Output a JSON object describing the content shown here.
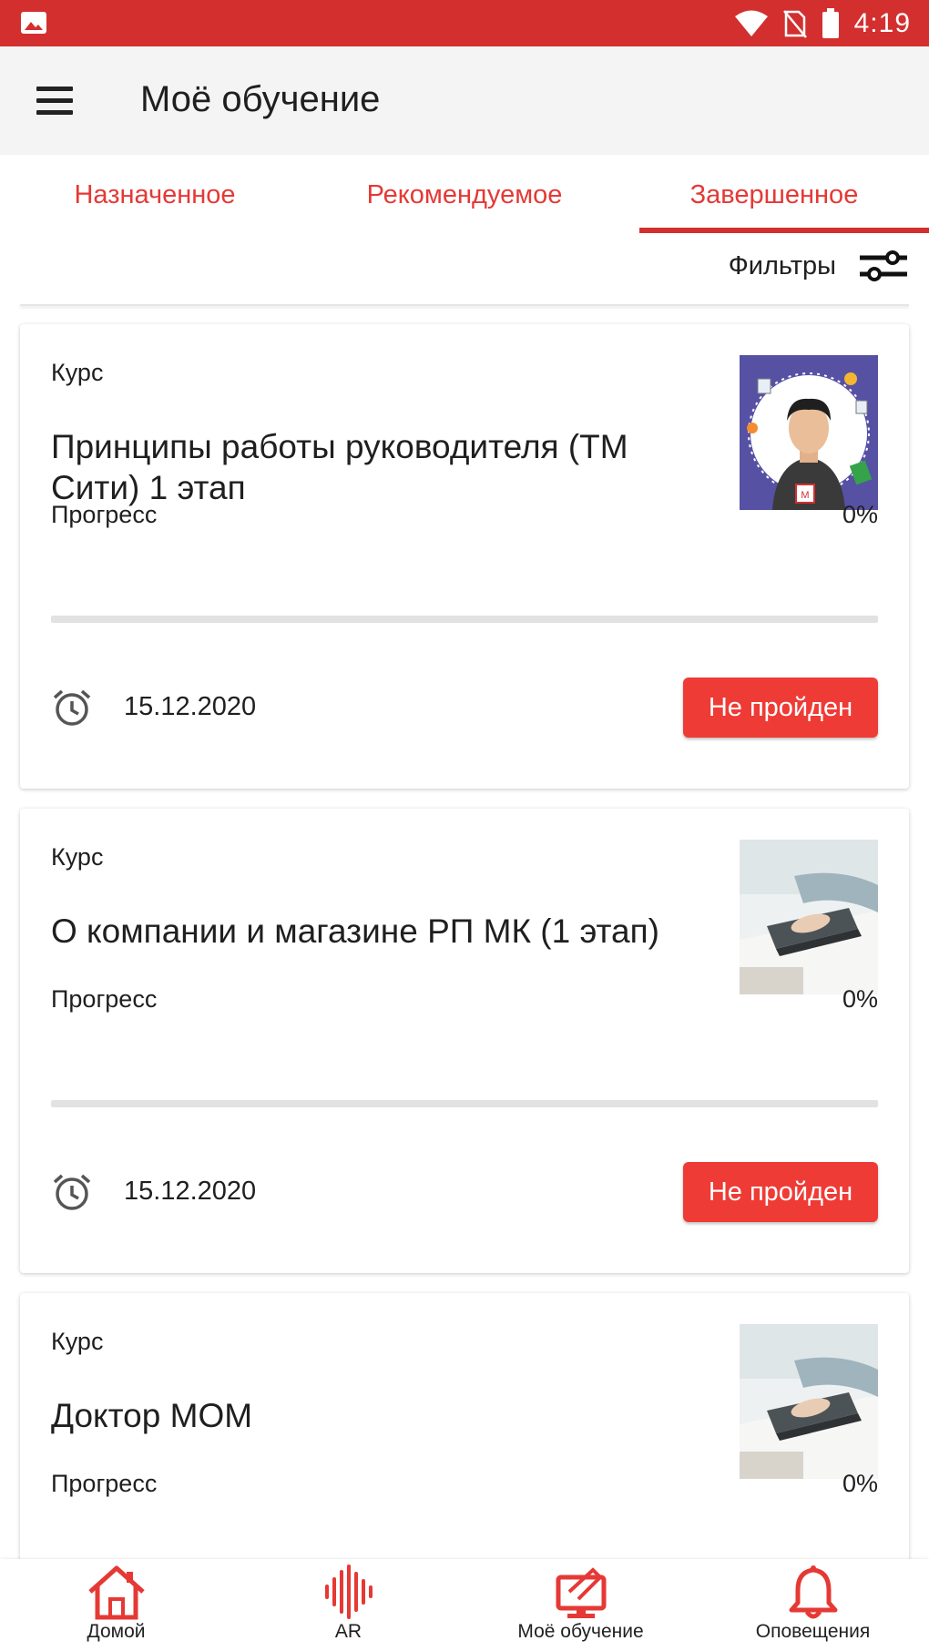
{
  "status_bar": {
    "time": "4:19",
    "left_icon": "image-icon",
    "right_icons": [
      "wifi-icon",
      "no-sim-icon",
      "battery-icon"
    ]
  },
  "app_bar": {
    "title": "Моё обучение",
    "menu_icon": "menu-icon"
  },
  "tabs": [
    {
      "label": "Назначенное",
      "active": false
    },
    {
      "label": "Рекомендуемое",
      "active": false
    },
    {
      "label": "Завершенное",
      "active": true
    }
  ],
  "filters": {
    "label": "Фильтры",
    "icon": "tune-icon"
  },
  "cards": [
    {
      "type": "Курс",
      "title": "Принципы работы руководителя  (ТМ Сити) 1 этап",
      "progress_label": "Прогресс",
      "progress_value": "0%",
      "progress_fraction": 0,
      "date": "15.12.2020",
      "status_button": "Не пройден",
      "thumbnail": "manager-avatar-thumbnail"
    },
    {
      "type": "Курс",
      "title": "О компании и магазине РП МК (1 этап)",
      "progress_label": "Прогресс",
      "progress_value": "0%",
      "progress_fraction": 0,
      "date": "15.12.2020",
      "status_button": "Не пройден",
      "thumbnail": "office-work-thumbnail"
    },
    {
      "type": "Курс",
      "title": "Доктор МОМ",
      "progress_label": "Прогресс",
      "progress_value": "0%",
      "progress_fraction": 0,
      "thumbnail": "office-work-thumbnail"
    }
  ],
  "bottom_nav": [
    {
      "label": "Домой",
      "icon": "home-icon"
    },
    {
      "label": "AR",
      "icon": "ar-waveform-icon"
    },
    {
      "label": "Моё обучение",
      "icon": "learning-icon"
    },
    {
      "label": "Оповещения",
      "icon": "bell-icon"
    }
  ],
  "colors": {
    "primary": "#d32f2f",
    "accent_button": "#ef3b36",
    "app_bar": "#f4f4f4",
    "track": "#e2e2e2"
  }
}
